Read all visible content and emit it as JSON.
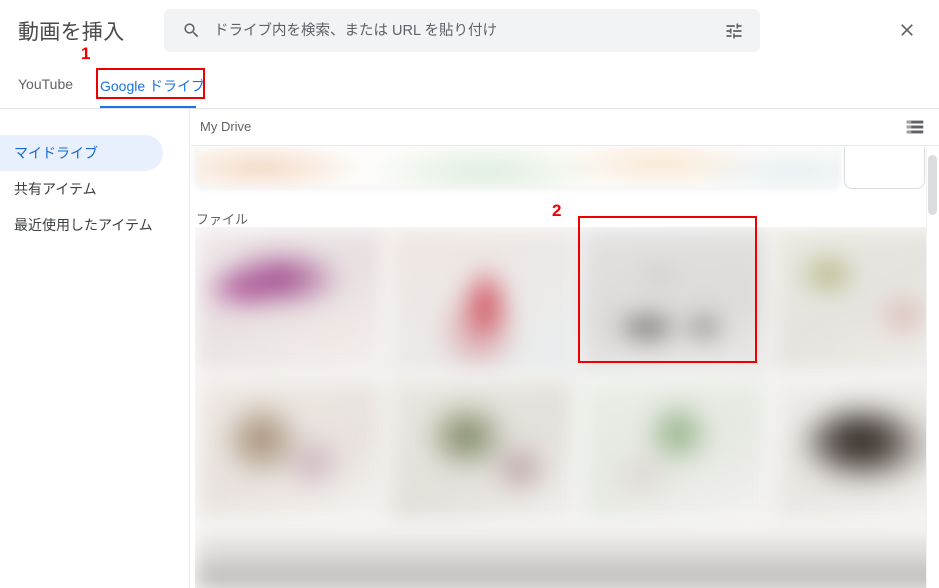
{
  "dialog": {
    "title": "動画を挿入",
    "close_label": "×",
    "close_icon": "close-icon"
  },
  "search": {
    "placeholder": "ドライブ内を検索、または URL を貼り付け",
    "value": "",
    "search_icon": "search-icon",
    "filter_icon": "tune-filter-icon"
  },
  "tabs": [
    {
      "label": "YouTube",
      "active": false
    },
    {
      "label": "Google ドライブ",
      "active": true
    }
  ],
  "sidebar": {
    "items": [
      {
        "label": "マイドライブ",
        "active": true
      },
      {
        "label": "共有アイテム",
        "active": false
      },
      {
        "label": "最近使用したアイテム",
        "active": false
      }
    ]
  },
  "content": {
    "breadcrumb": "My Drive",
    "view_toggle_icon": "list-view-icon",
    "sections": {
      "files_label": "ファイル"
    }
  },
  "annotations": [
    {
      "number": "1",
      "target": "google-drive-tab"
    },
    {
      "number": "2",
      "target": "file-thumbnail"
    }
  ],
  "colors": {
    "accent_blue": "#1a73e8",
    "sidebar_active_bg": "#e8f0fe",
    "sidebar_active_text": "#1967d2",
    "annotation_red": "#ee0000",
    "search_bg": "#f1f3f4",
    "text_primary": "#3c4043",
    "text_secondary": "#5f6368"
  }
}
